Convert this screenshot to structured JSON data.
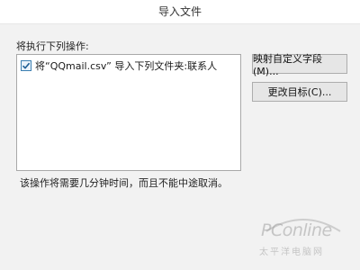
{
  "window": {
    "title": "导入文件"
  },
  "dialog": {
    "section_label": "将执行下列操作:",
    "actions": [
      {
        "label": "将“QQmail.csv” 导入下列文件夹:联系人",
        "checked": true
      }
    ],
    "buttons": {
      "map_fields": "映射自定义字段(M)...",
      "change_target": "更改目标(C)..."
    },
    "note": "该操作将需要几分钟时间，而且不能中途取消。"
  },
  "watermark": {
    "text": "PConline",
    "subtext": "太平洋电脑网"
  },
  "colors": {
    "dialog_bg": "#f2f2f2",
    "checkbox_accent": "#3c7fb1"
  }
}
